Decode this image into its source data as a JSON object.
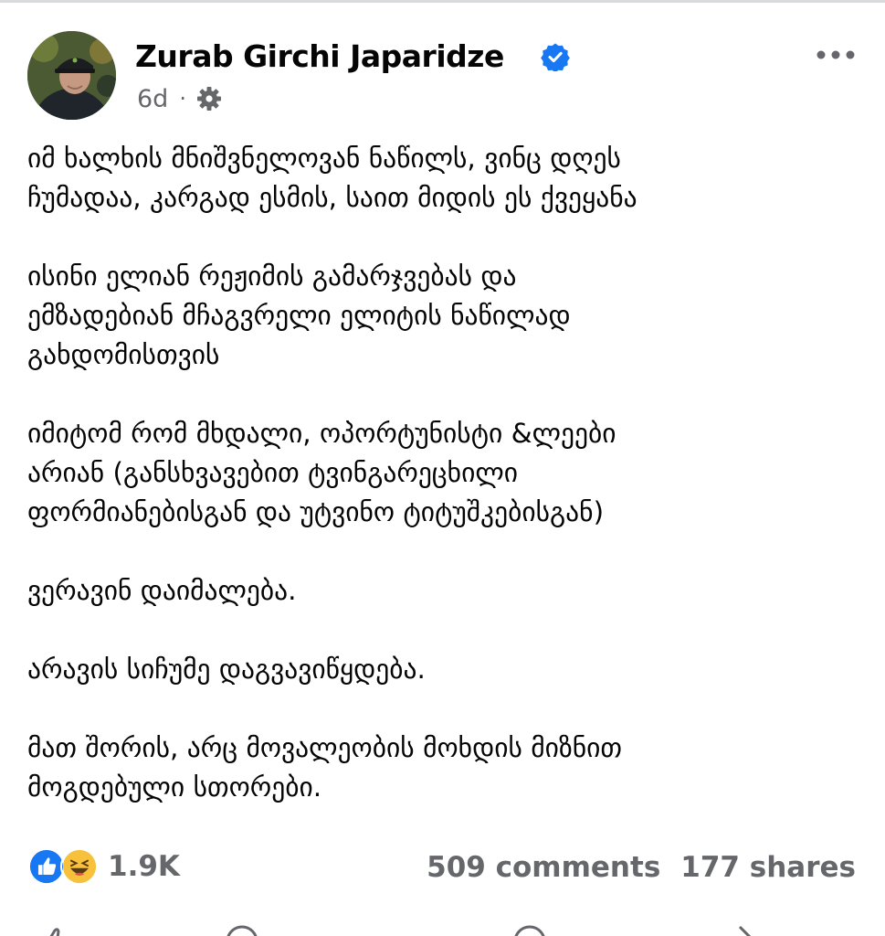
{
  "post": {
    "author": "Zurab Girchi Japaridze",
    "time": "6d",
    "separator": "·",
    "paragraphs": [
      "იმ ხალხის მნიშვნელოვან ნაწილს, ვინც დღეს\nჩუმადაა, კარგად ესმის, საით მიდის ეს ქვეყანა",
      "ისინი ელიან რეჟიმის გამარჯვებას და\nემზადებიან მჩაგვრელი ელიტის ნაწილად\nგახდომისთვის",
      "იმიტომ რომ მხდალი, ოპორტუნისტი &ლეები\nარიან (განსხვავებით ტვინგარეცხილი\nფორმიანებისგან და უტვინო ტიტუშკებისგან)",
      "ვერავინ დაიმალება.",
      "არავის სიჩუმე დაგვავიწყდება.",
      "მათ შორის, არც მოვალეობის მოხდის მიზნით\nმოგდებული სთორები."
    ]
  },
  "engagement": {
    "reactions": "1.9K",
    "comments": "509 comments",
    "shares": "177 shares"
  },
  "icons": {
    "verified": "verified-badge-icon",
    "audience": "gear-icon",
    "more": "more-options-icon",
    "like_reaction": "like-reaction-icon",
    "haha_reaction": "haha-reaction-icon"
  },
  "colors": {
    "accent": "#1877f2",
    "secondary_text": "#65676b",
    "primary_text": "#050505",
    "haha_yellow": "#f7c13c"
  }
}
